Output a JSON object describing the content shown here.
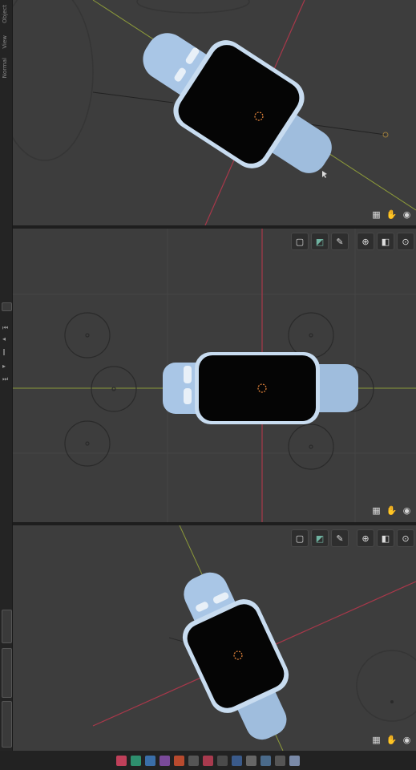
{
  "left_strip": {
    "menu_items": [
      "Object",
      "View",
      "Normal"
    ]
  },
  "viewports": [
    {
      "name": "top-viewport",
      "nav_icons": [
        "grid-icon",
        "hand-icon",
        "camera-icon"
      ]
    },
    {
      "name": "middle-viewport",
      "header_tools": [
        "select-box-icon",
        "shading-icon",
        "annotate-icon",
        "pivot-icon",
        "overlay-icon",
        "gizmo-icon"
      ],
      "nav_icons": [
        "grid-icon",
        "hand-icon",
        "camera-icon"
      ]
    },
    {
      "name": "bottom-viewport",
      "header_tools": [
        "select-box-icon",
        "shading-icon",
        "annotate-icon",
        "pivot-icon",
        "overlay-icon",
        "gizmo-icon"
      ],
      "nav_icons": [
        "grid-icon",
        "hand-icon",
        "camera-icon"
      ]
    }
  ],
  "taskbar": {
    "icons": [
      "app-icon-1",
      "app-icon-2",
      "app-icon-3",
      "app-icon-4",
      "app-icon-5",
      "app-icon-6",
      "app-icon-7",
      "app-icon-8",
      "app-icon-9",
      "app-icon-10",
      "app-icon-11",
      "app-icon-12",
      "app-icon-13"
    ]
  },
  "colors": {
    "viewport_bg": "#3d3d3d",
    "watch_band": "#a9c6e6",
    "watch_screen": "#050505",
    "axis_x": "#a8384a",
    "axis_y": "#8c9a3a",
    "origin_marker": "#e0823a"
  }
}
